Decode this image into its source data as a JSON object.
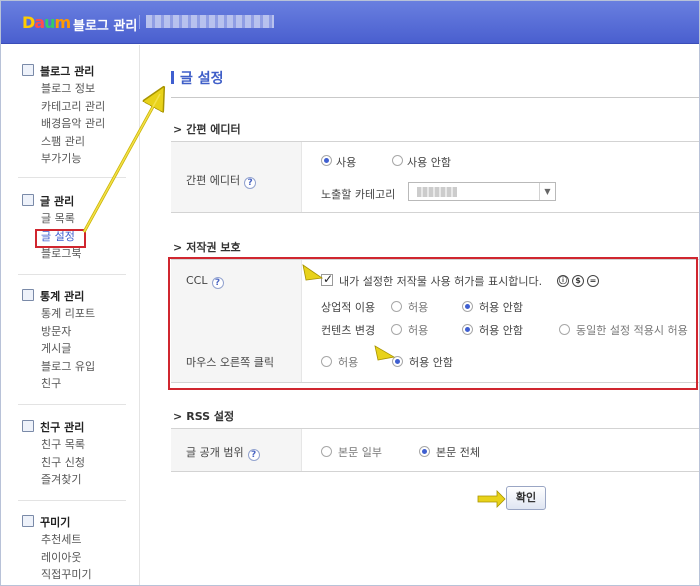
{
  "header": {
    "logo": {
      "p1": "D",
      "p2": "a",
      "p3": "u",
      "p4": "m"
    },
    "app_title": "블로그 관리"
  },
  "sidebar": {
    "groups": [
      {
        "title": "블로그 관리",
        "icon": "blog-manage-icon",
        "items": [
          "블로그 정보",
          "카테고리 관리",
          "배경음악 관리",
          "스팸 관리",
          "부가기능"
        ]
      },
      {
        "title": "글 관리",
        "icon": "post-manage-icon",
        "items": [
          "글 목록",
          "글 설정",
          "블로그북"
        ]
      },
      {
        "title": "통계 관리",
        "icon": "stats-icon",
        "items": [
          "통계 리포트",
          "방문자",
          "게시글",
          "블로그 유입",
          "친구"
        ]
      },
      {
        "title": "친구 관리",
        "icon": "friends-icon",
        "items": [
          "친구 목록",
          "친구 신청",
          "즐겨찾기"
        ]
      },
      {
        "title": "꾸미기",
        "icon": "decorate-icon",
        "items": [
          "추천세트",
          "레이아웃",
          "직접꾸미기"
        ]
      }
    ]
  },
  "main": {
    "title": "글 설정",
    "sections": {
      "editor": {
        "title": "간편 에디터",
        "label": "간편 에디터",
        "help": "?",
        "opt_use": "사용",
        "opt_nouse": "사용 안함",
        "selected": "사용",
        "category_label": "노출할 카테고리"
      },
      "copyright": {
        "title": "저작권 보호",
        "ccl_label": "CCL",
        "help": "?",
        "ccl_checkbox": "내가 설정한 저작물 사용 허가를 표시합니다.",
        "ccl_checked": true,
        "cc_icons": [
          "ⓘ",
          "$",
          "="
        ],
        "commercial_label": "상업적 이용",
        "change_label": "컨텐츠 변경",
        "opt_allow": "허용",
        "opt_deny": "허용 안함",
        "opt_same": "동일한 설정 적용시 허용",
        "commercial_selected": "허용 안함",
        "change_selected": "허용 안함",
        "rightclick_label": "마우스 오른쪽 클릭",
        "rightclick_allow": "허용",
        "rightclick_deny": "허용 안함",
        "rightclick_selected": "허용 안함"
      },
      "rss": {
        "title": "RSS 설정",
        "label": "글 공개 범위",
        "help": "?",
        "opt_partial": "본문 일부",
        "opt_full": "본문 전체",
        "selected": "본문 전체"
      }
    },
    "confirm_label": "확인"
  },
  "colors": {
    "header": "#5a70d8",
    "accent": "#3f5fd0",
    "highlight_box": "#d0262f",
    "arrow": "#e8d21a"
  }
}
